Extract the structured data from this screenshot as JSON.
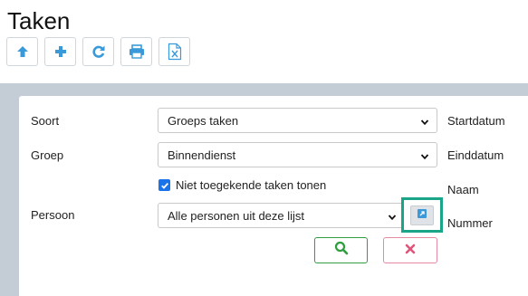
{
  "page": {
    "title": "Taken"
  },
  "toolbar": {
    "buttons": [
      {
        "icon": "arrow-up-icon",
        "color": "#3a9ad9"
      },
      {
        "icon": "plus-icon",
        "color": "#3a9ad9"
      },
      {
        "icon": "refresh-icon",
        "color": "#3a9ad9"
      },
      {
        "icon": "print-icon",
        "color": "#3a9ad9"
      },
      {
        "icon": "excel-file-icon",
        "color": "#3a9ad9"
      }
    ]
  },
  "filters": {
    "soort": {
      "label": "Soort",
      "value": "Groeps taken"
    },
    "groep": {
      "label": "Groep",
      "value": "Binnendienst"
    },
    "checkbox": {
      "label": "Niet toegekende taken tonen",
      "checked": true
    },
    "persoon": {
      "label": "Persoon",
      "value": "Alle personen uit deze lijst"
    }
  },
  "right_labels": {
    "startdatum": "Startdatum",
    "einddatum": "Einddatum",
    "naam": "Naam",
    "nummer": "Nummer"
  },
  "actions": {
    "search_icon": "search-icon",
    "clear_icon": "close-icon",
    "edit_icon": "external-link-icon"
  },
  "colors": {
    "accent_blue": "#3a9ad9",
    "search_green": "#2e9e3e",
    "clear_pink": "#e58aa0",
    "highlight_teal": "#1aa589",
    "backdrop": "#c4ccd6"
  }
}
